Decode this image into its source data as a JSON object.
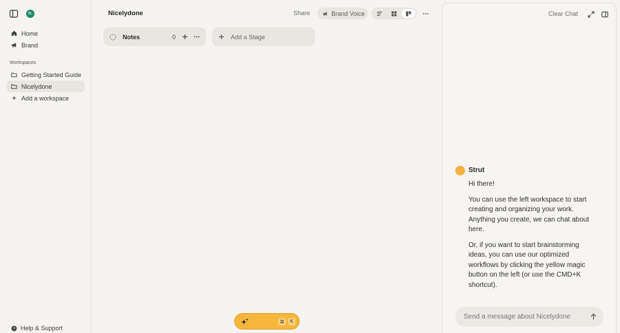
{
  "sidebar": {
    "avatar_initials": "BL",
    "nav": [
      {
        "label": "Home",
        "icon": "home-icon"
      },
      {
        "label": "Brand",
        "icon": "megaphone-icon"
      }
    ],
    "section_label": "Workspaces",
    "workspaces": [
      {
        "label": "Getting Started Guide",
        "icon": "folder-icon",
        "active": false
      },
      {
        "label": "Nicelydone",
        "icon": "folder-icon",
        "active": true
      }
    ],
    "add_workspace_label": "Add a workspace",
    "help_label": "Help & Support"
  },
  "header": {
    "title": "Nicelydone",
    "share_label": "Share",
    "brand_voice_label": "Brand Voice",
    "views": [
      "list-view",
      "grid-view",
      "board-view"
    ],
    "active_view": "board-view"
  },
  "board": {
    "stages": [
      {
        "name": "Notes",
        "count": "0"
      }
    ],
    "add_stage_label": "Add a Stage"
  },
  "magic_button": {
    "keys": [
      "⌘",
      "K"
    ],
    "color": "#f6b73c"
  },
  "chat": {
    "clear_label": "Clear Chat",
    "bot_name": "Strut",
    "bot_color": "#f5b041",
    "messages": [
      "Hi there!",
      "You can use the left workspace to start creating and organizing your work. Anything you create, we can chat about here.",
      "Or, if you want to start brainstorming ideas, you can use our optimized workflows by clicking the yellow magic button on the left (or use the CMD+K shortcut)."
    ],
    "input_placeholder": "Send a message about Nicelydone"
  }
}
